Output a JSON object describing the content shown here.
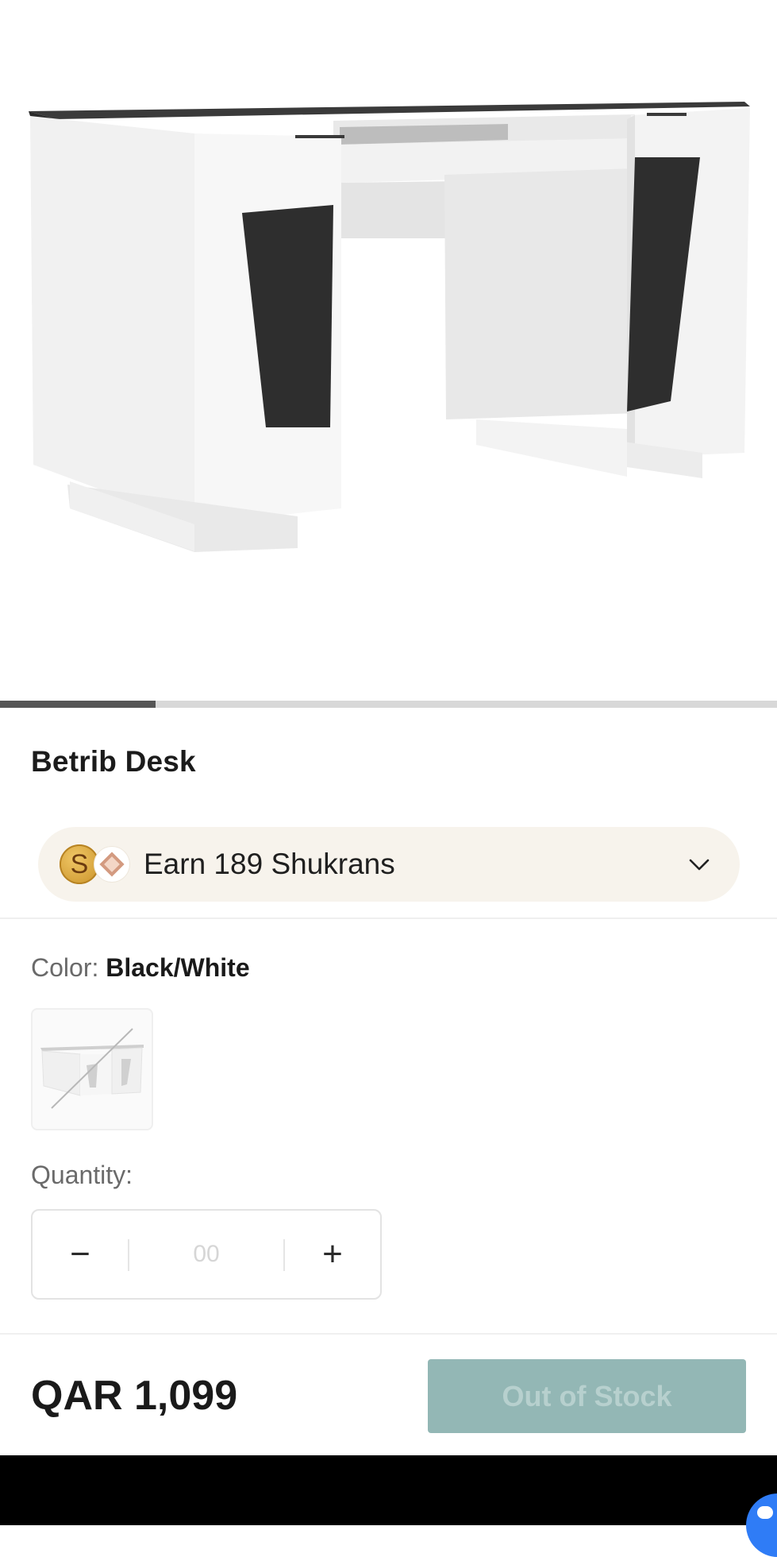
{
  "product": {
    "title": "Betrib Desk",
    "image_alt": "white desk with black panels"
  },
  "carousel": {
    "current_slide": 1,
    "total_slides": 5
  },
  "shukran": {
    "coin_letter": "S",
    "text": "Earn 189 Shukrans"
  },
  "color": {
    "label": "Color:",
    "value": "Black/White"
  },
  "quantity": {
    "label": "Quantity:",
    "minus": "−",
    "value": "00",
    "plus": "+"
  },
  "footer": {
    "price": "QAR 1,099",
    "button_label": "Out of Stock"
  },
  "colors": {
    "accent_disabled": "#93b7b5",
    "pill_bg": "#f7f3ec",
    "chat_blue": "#2f7cf6"
  },
  "icons": {
    "shukran_chevron": "chevron-down-icon",
    "coin": "shukran-coin-icon",
    "diamond": "diamond-icon",
    "chat": "chat-bubble-icon"
  }
}
